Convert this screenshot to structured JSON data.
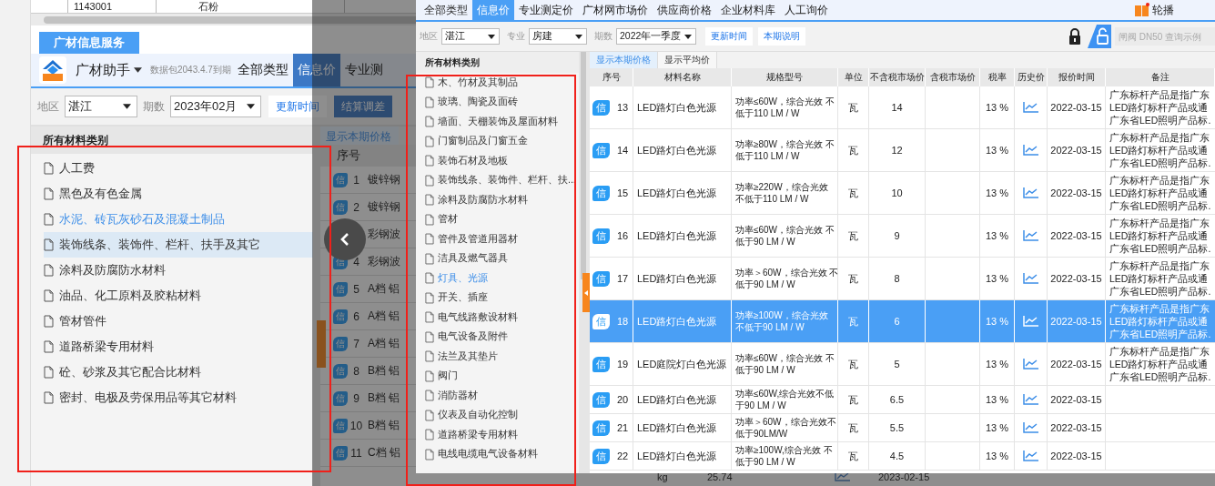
{
  "background_window": {
    "top_row": [
      "1143001",
      "石粉"
    ],
    "service_tab": "广材信息服务",
    "app_name": "广材助手",
    "package_notice": "数据包2043.4.7到期",
    "nav_tabs": [
      {
        "label": "全部类型",
        "selected": false
      },
      {
        "label": "信息价",
        "selected": true
      },
      {
        "label": "专业测",
        "selected": false
      }
    ],
    "filters": [
      {
        "label": "地区",
        "value": "湛江"
      },
      {
        "label": "期数",
        "value": "2023年02月"
      }
    ],
    "buttons": [
      {
        "label": "更新时间",
        "kind": "plain"
      },
      {
        "label": "结算调差",
        "kind": "primary"
      }
    ],
    "tree_title": "所有材料类别",
    "categories": [
      {
        "label": "人工费",
        "selected": false,
        "highlighted": false
      },
      {
        "label": "黑色及有色金属",
        "selected": false,
        "highlighted": false
      },
      {
        "label": "水泥、砖瓦灰砂石及混凝土制品",
        "selected": true,
        "highlighted": false
      },
      {
        "label": "装饰线条、装饰件、栏杆、扶手及其它",
        "selected": false,
        "highlighted": true
      },
      {
        "label": "涂料及防腐防水材料",
        "selected": false,
        "highlighted": false
      },
      {
        "label": "油品、化工原料及胶粘材料",
        "selected": false,
        "highlighted": false
      },
      {
        "label": "管材管件",
        "selected": false,
        "highlighted": false
      },
      {
        "label": "道路桥梁专用材料",
        "selected": false,
        "highlighted": false
      },
      {
        "label": "砼、砂浆及其它配合比材料",
        "selected": false,
        "highlighted": false
      },
      {
        "label": "密封、电极及劳保用品等其它材料",
        "selected": false,
        "highlighted": false
      }
    ],
    "price_tab": "显示本期价格",
    "index_header": "序号",
    "rows": [
      {
        "badge": "信",
        "index": "1",
        "name": "镀锌钢"
      },
      {
        "badge": "信",
        "index": "2",
        "name": "镀锌钢"
      },
      {
        "name": "彩钢波"
      },
      {
        "badge": "信",
        "index": "4",
        "name": "彩钢波"
      },
      {
        "badge": "信",
        "index": "5",
        "name": "A档 铝"
      },
      {
        "badge": "信",
        "index": "6",
        "name": "A档 铝"
      },
      {
        "badge": "信",
        "index": "7",
        "name": "A档 铝"
      },
      {
        "badge": "信",
        "index": "8",
        "name": "B档 铝"
      },
      {
        "badge": "信",
        "index": "9",
        "name": "B档 铝"
      },
      {
        "badge": "信",
        "index": "10",
        "name": "B档 铝"
      },
      {
        "badge": "信",
        "index": "11",
        "name": "C档 铝"
      }
    ],
    "bottom_row": {
      "unit": "kg",
      "price": "25.74",
      "date": "2023-02-15"
    }
  },
  "foreground_window": {
    "nav_tabs": [
      {
        "label": "全部类型",
        "selected": false
      },
      {
        "label": "信息价",
        "selected": true
      },
      {
        "label": "专业测定价",
        "selected": false
      },
      {
        "label": "广材网市场价",
        "selected": false
      },
      {
        "label": "供应商价格",
        "selected": false
      },
      {
        "label": "企业材料库",
        "selected": false
      },
      {
        "label": "人工询价",
        "selected": false
      }
    ],
    "carousel_label": "轮播",
    "filters": [
      {
        "label": "地区",
        "value": "湛江"
      },
      {
        "label": "专业",
        "value": "房建"
      },
      {
        "label": "期数",
        "value": "2022年一季度"
      }
    ],
    "buttons": [
      "更新时间",
      "本期说明"
    ],
    "search": {
      "placeholder": "闸阀 DN50 查询示例"
    },
    "tree_title": "所有材料类别",
    "categories": [
      {
        "label": "木、竹材及其制品",
        "selected": false
      },
      {
        "label": "玻璃、陶瓷及面砖",
        "selected": false
      },
      {
        "label": "墙面、天棚装饰及屋面材料",
        "selected": false
      },
      {
        "label": "门窗制品及门窗五金",
        "selected": false
      },
      {
        "label": "装饰石材及地板",
        "selected": false
      },
      {
        "label": "装饰线条、装饰件、栏杆、扶...",
        "selected": false
      },
      {
        "label": "涂料及防腐防水材料",
        "selected": false
      },
      {
        "label": "管材",
        "selected": false
      },
      {
        "label": "管件及管道用器材",
        "selected": false
      },
      {
        "label": "洁具及燃气器具",
        "selected": false
      },
      {
        "label": "灯具、光源",
        "selected": true
      },
      {
        "label": "开关、插座",
        "selected": false
      },
      {
        "label": "电气线路敷设材料",
        "selected": false
      },
      {
        "label": "电气设备及附件",
        "selected": false
      },
      {
        "label": "法兰及其垫片",
        "selected": false
      },
      {
        "label": "阀门",
        "selected": false
      },
      {
        "label": "消防器材",
        "selected": false
      },
      {
        "label": "仪表及自动化控制",
        "selected": false
      },
      {
        "label": "道路桥梁专用材料",
        "selected": false
      },
      {
        "label": "电线电缆电气设备材料",
        "selected": false
      }
    ],
    "price_tabs": [
      {
        "label": "显示本期价格",
        "selected": true
      },
      {
        "label": "显示平均价",
        "selected": false
      }
    ],
    "columns": [
      "序号",
      "材料名称",
      "规格型号",
      "单位",
      "不含税市场价",
      "含税市场价",
      "税率",
      "历史价",
      "报价时间",
      "备注"
    ],
    "rows": [
      {
        "badge": "信",
        "index": "13",
        "name": "LED路灯白色光源",
        "spec": [
          "功率≤60W，综合光效 不",
          "低于110 LM / W"
        ],
        "unit": "瓦",
        "price": "14",
        "tax_rate": "13 %",
        "date": "2022-03-15",
        "remark": [
          "广东标杆产品是指广东",
          "LED路灯标杆产品或通",
          "广东省LED照明产品标."
        ],
        "selected": false
      },
      {
        "badge": "信",
        "index": "14",
        "name": "LED路灯白色光源",
        "spec": [
          "功率≥80W，综合光效 不",
          "低于110 LM / W"
        ],
        "unit": "瓦",
        "price": "12",
        "tax_rate": "13 %",
        "date": "2022-03-15",
        "remark": [
          "广东标杆产品是指广东",
          "LED路灯标杆产品或通",
          "广东省LED照明产品标."
        ],
        "selected": false
      },
      {
        "badge": "信",
        "index": "15",
        "name": "LED路灯白色光源",
        "spec": [
          "功率≥220W，综合光效",
          "不低于110 LM / W"
        ],
        "unit": "瓦",
        "price": "10",
        "tax_rate": "13 %",
        "date": "2022-03-15",
        "remark": [
          "广东标杆产品是指广东",
          "LED路灯标杆产品或通",
          "广东省LED照明产品标."
        ],
        "selected": false
      },
      {
        "badge": "信",
        "index": "16",
        "name": "LED路灯白色光源",
        "spec": [
          "功率≤60W，综合光效 不",
          "低于90 LM / W"
        ],
        "unit": "瓦",
        "price": "9",
        "tax_rate": "13 %",
        "date": "2022-03-15",
        "remark": [
          "广东标杆产品是指广东",
          "LED路灯标杆产品或通",
          "广东省LED照明产品标."
        ],
        "selected": false
      },
      {
        "badge": "信",
        "index": "17",
        "name": "LED路灯白色光源",
        "spec": [
          "功率＞60W，综合光效 不",
          "低于90 LM / W"
        ],
        "unit": "瓦",
        "price": "8",
        "tax_rate": "13 %",
        "date": "2022-03-15",
        "remark": [
          "广东标杆产品是指广东",
          "LED路灯标杆产品或通",
          "广东省LED照明产品标."
        ],
        "selected": false
      },
      {
        "badge": "信",
        "index": "18",
        "name": "LED路灯白色光源",
        "spec": [
          "功率≥100W，综合光效",
          "不低于90 LM / W"
        ],
        "unit": "瓦",
        "price": "6",
        "tax_rate": "13 %",
        "date": "2022-03-15",
        "remark": [
          "广东标杆产品是指广东",
          "LED路灯标杆产品或通",
          "广东省LED照明产品标."
        ],
        "selected": true
      },
      {
        "badge": "信",
        "index": "19",
        "name": "LED庭院灯白色光源",
        "spec": [
          "功率≤60W，综合光效 不",
          "低于90 LM / W"
        ],
        "unit": "瓦",
        "price": "5",
        "tax_rate": "13 %",
        "date": "2022-03-15",
        "remark": [
          "广东标杆产品是指广东",
          "LED路灯标杆产品或通",
          "广东省LED照明产品标."
        ],
        "selected": false
      },
      {
        "badge": "信",
        "index": "20",
        "name": "LED路灯白色光源",
        "spec": [
          "功率≤60W,综合光效不低",
          "于90 LM / W"
        ],
        "unit": "瓦",
        "price": "6.5",
        "tax_rate": "13 %",
        "date": "2022-03-15",
        "selected": false
      },
      {
        "badge": "信",
        "index": "21",
        "name": "LED路灯白色光源",
        "spec": [
          "功率＞60W，综合光效不",
          "低于90LM/W"
        ],
        "unit": "瓦",
        "price": "5.5",
        "tax_rate": "13 %",
        "date": "2022-03-15",
        "selected": false
      },
      {
        "badge": "信",
        "index": "22",
        "name": "LED路灯白色光源",
        "spec": [
          "功率≥100W,综合光效 不",
          "低于90 LM / W"
        ],
        "unit": "瓦",
        "price": "4.5",
        "tax_rate": "13 %",
        "date": "2022-03-15",
        "selected": false
      }
    ]
  }
}
